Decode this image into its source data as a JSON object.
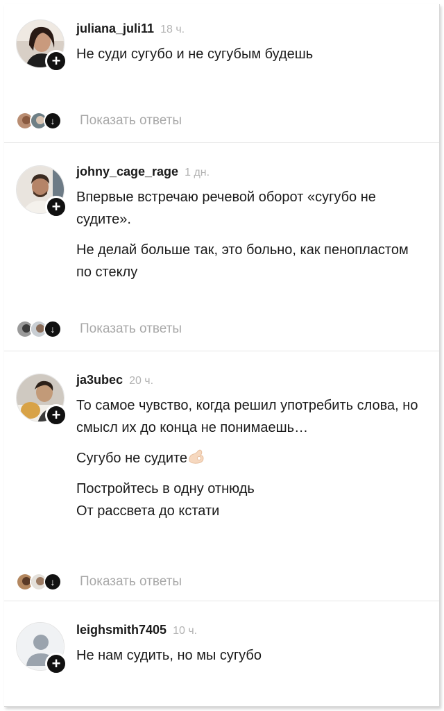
{
  "comments": [
    {
      "username": "juliana_juli11",
      "time": "18 ч.",
      "paragraphs": [
        "Не суди сугубо и не сугубым будешь"
      ],
      "show_replies": "Показать ответы"
    },
    {
      "username": "johny_cage_rage",
      "time": "1 дн.",
      "paragraphs": [
        "Впервые встречаю речевой оборот «сугубо не судите».",
        "Не делай больше так, это больно, как пенопластом по стеклу"
      ],
      "show_replies": "Показать ответы"
    },
    {
      "username": "ja3ubec",
      "time": "20 ч.",
      "paragraphs": [
        "То самое чувство, когда решил употребить слова, но смысл их до конца не понимаешь…",
        "Сугубо не судите",
        "Постройтесь в одну отнюдь\nОт рассвета до кстати"
      ],
      "show_replies": "Показать ответы"
    },
    {
      "username": "leighsmith7405",
      "time": "10 ч.",
      "paragraphs": [
        "Не нам судить, но мы сугубо"
      ]
    }
  ],
  "icons": {
    "add": "plus-icon",
    "expand": "arrow-down-icon",
    "emoji": "ok-hand-emoji"
  },
  "colors": {
    "badge": "#111111",
    "muted_text": "#a8a8a8",
    "time_text": "#b3b3b3"
  }
}
